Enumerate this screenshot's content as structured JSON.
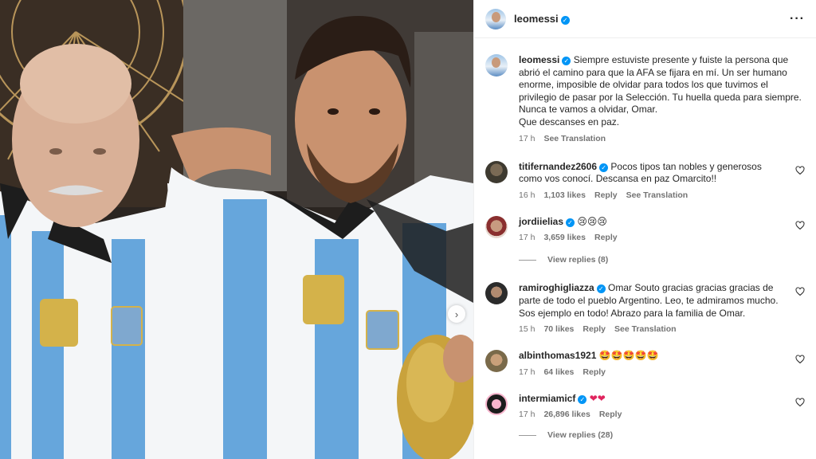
{
  "post": {
    "author": "leomessi",
    "caption_lines": [
      "Siempre estuviste presente y fuiste la persona que",
      "abrió el camino para que la AFA se fijara en mí. Un ser humano",
      "enorme, imposible de olvidar para todos los que tuvimos el",
      "privilegio de pasar por la Selección. Tu huella queda para siempre.",
      "Nunca te vamos a olvidar, Omar.",
      "Que descanses en paz."
    ],
    "caption_time": "17 h",
    "caption_translate": "See Translation"
  },
  "comments": [
    {
      "user": "titifernandez2606",
      "verified": true,
      "text": "Pocos tipos tan nobles y generosos como vos conocí. Descansa en paz Omarcito!!",
      "time": "16 h",
      "likes": "1,103 likes",
      "reply": "Reply",
      "translate": "See Translation"
    },
    {
      "user": "jordiielias",
      "verified": true,
      "text": "",
      "emoji": "😢😢😢",
      "time": "17 h",
      "likes": "3,659 likes",
      "reply": "Reply",
      "view_replies": "View replies (8)"
    },
    {
      "user": "ramiroghigliazza",
      "verified": true,
      "text": "Omar Souto gracias gracias gracias de parte de todo el pueblo Argentino. Leo, te admiramos mucho. Sos ejemplo en todo! Abrazo para la familia de Omar.",
      "time": "15 h",
      "likes": "70 likes",
      "reply": "Reply",
      "translate": "See Translation"
    },
    {
      "user": "albinthomas1921",
      "verified": false,
      "emoji": "🤩🤩🤩🤩🤩",
      "time": "17 h",
      "likes": "64 likes",
      "reply": "Reply"
    },
    {
      "user": "intermiamicf",
      "verified": true,
      "emoji": "❤❤",
      "time": "17 h",
      "likes": "26,896 likes",
      "reply": "Reply",
      "view_replies": "View replies (28)"
    }
  ],
  "colors": {
    "verified": "#0095f6",
    "meta": "#737373",
    "heart_emoji": "#e0245e"
  },
  "icons": {
    "more": "more-options-icon",
    "heart": "heart-outline-icon",
    "next": "chevron-right-icon"
  }
}
